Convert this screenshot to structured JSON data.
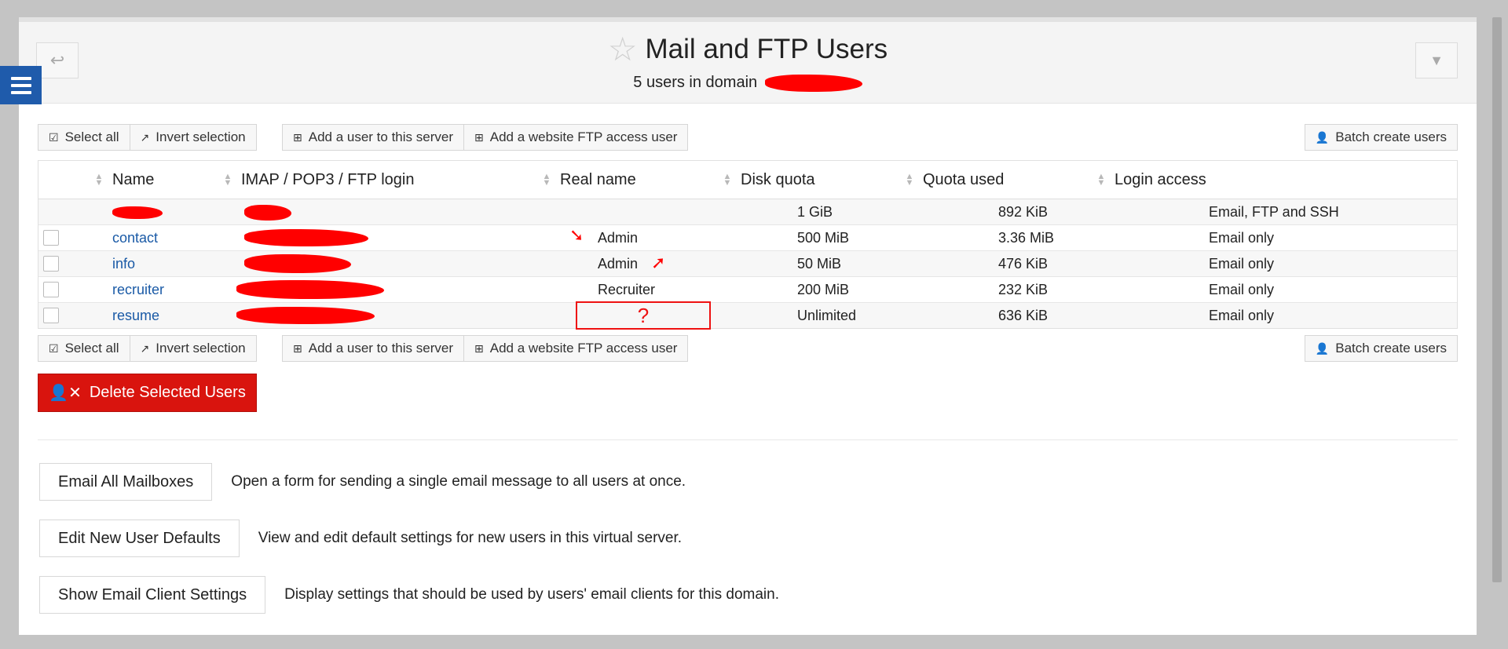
{
  "header": {
    "title": "Mail and FTP Users",
    "subtitle": "5 users in domain"
  },
  "toolbar": {
    "select_all": "Select all",
    "invert_selection": "Invert selection",
    "add_user": "Add a user to this server",
    "add_ftp_user": "Add a website FTP access user",
    "batch_create": "Batch create users"
  },
  "table": {
    "columns": {
      "name": "Name",
      "login": "IMAP / POP3 / FTP login",
      "real_name": "Real name",
      "disk_quota": "Disk quota",
      "quota_used": "Quota used",
      "login_access": "Login access"
    },
    "rows": [
      {
        "name": "",
        "real_name": "",
        "disk_quota": "1 GiB",
        "quota_used": "892 KiB",
        "login_access": "Email, FTP and SSH"
      },
      {
        "name": "contact",
        "real_name": "Admin",
        "disk_quota": "500 MiB",
        "quota_used": "3.36 MiB",
        "login_access": "Email only"
      },
      {
        "name": "info",
        "real_name": "Admin",
        "disk_quota": "50 MiB",
        "quota_used": "476 KiB",
        "login_access": "Email only"
      },
      {
        "name": "recruiter",
        "real_name": "Recruiter",
        "disk_quota": "200 MiB",
        "quota_used": "232 KiB",
        "login_access": "Email only"
      },
      {
        "name": "resume",
        "real_name": "?",
        "disk_quota": "Unlimited",
        "quota_used": "636 KiB",
        "login_access": "Email only"
      }
    ]
  },
  "delete_button": "Delete Selected Users",
  "actions": [
    {
      "label": "Email All Mailboxes",
      "desc": "Open a form for sending a single email message to all users at once."
    },
    {
      "label": "Edit New User Defaults",
      "desc": "View and edit default settings for new users in this virtual server."
    },
    {
      "label": "Show Email Client Settings",
      "desc": "Display settings that should be used by users' email clients for this domain."
    }
  ],
  "colors": {
    "accent_blue": "#1f5bab",
    "link": "#1a5aa6",
    "danger": "#d9140e",
    "redaction": "#ff0000"
  }
}
